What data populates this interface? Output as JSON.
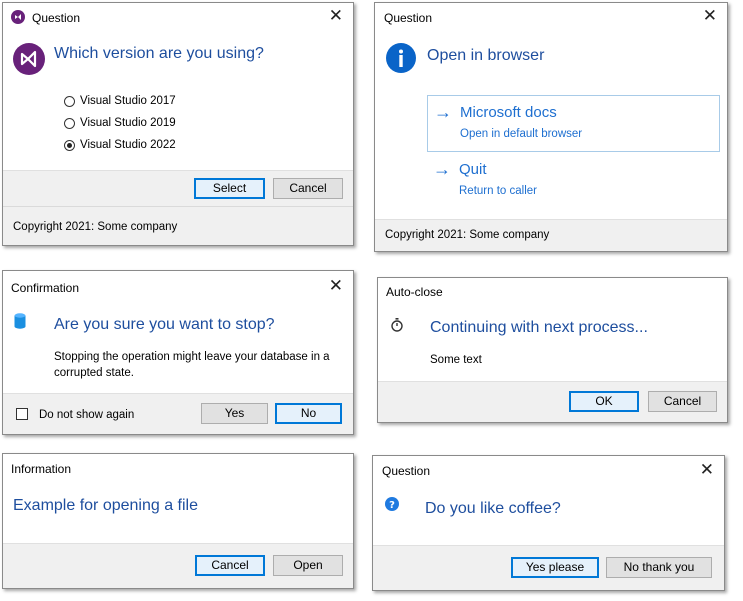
{
  "dialogs": {
    "version": {
      "title": "Question",
      "heading": "Which version are you using?",
      "options": [
        {
          "label": "Visual Studio 2017",
          "checked": false
        },
        {
          "label": "Visual Studio 2019",
          "checked": false
        },
        {
          "label": "Visual Studio 2022",
          "checked": true
        }
      ],
      "select_label": "Select",
      "cancel_label": "Cancel",
      "footer": "Copyright 2021: Some company"
    },
    "browser": {
      "title": "Question",
      "heading": "Open in browser",
      "links": [
        {
          "title": "Microsoft docs",
          "subtitle": "Open in default browser"
        },
        {
          "title": "Quit",
          "subtitle": "Return to caller"
        }
      ],
      "footer": "Copyright 2021: Some company"
    },
    "confirm": {
      "title": "Confirmation",
      "heading": "Are you sure you want to stop?",
      "text": "Stopping the operation might leave your database in a corrupted state.",
      "checkbox_label": "Do not show again",
      "yes_label": "Yes",
      "no_label": "No"
    },
    "autoclose": {
      "title": "Auto-close",
      "heading": "Continuing with next process...",
      "text": "Some text",
      "ok_label": "OK",
      "cancel_label": "Cancel"
    },
    "information": {
      "title": "Information",
      "heading": "Example for opening a file",
      "cancel_label": "Cancel",
      "open_label": "Open"
    },
    "coffee": {
      "title": "Question",
      "heading": "Do you like coffee?",
      "yes_label": "Yes please",
      "no_label": "No thank you"
    }
  },
  "icons": {
    "close": "close-icon",
    "vs_logo": "visual-studio-logo-icon",
    "info": "info-icon",
    "database": "database-icon",
    "stopwatch": "stopwatch-icon",
    "question": "question-icon",
    "arrow": "arrow-right-icon"
  },
  "colors": {
    "heading": "#1e4e9e",
    "link": "#1e6fd0",
    "info_blue": "#0a64c8",
    "vs_purple": "#68217a",
    "default_button": "#0078d7",
    "footer_bg": "#f0f0f0"
  }
}
